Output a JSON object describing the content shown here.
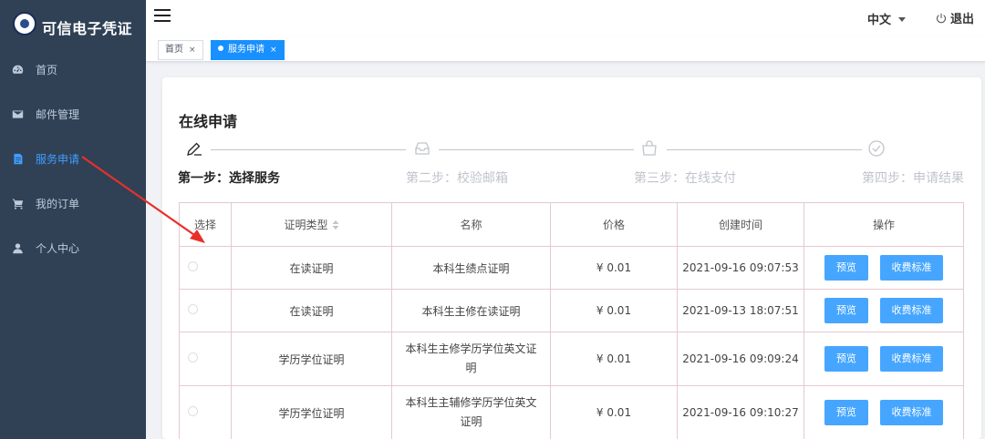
{
  "sidebar": {
    "brand": "可信电子凭证",
    "items": [
      {
        "label": "首页",
        "icon": "dashboard-icon"
      },
      {
        "label": "邮件管理",
        "icon": "envelope-icon"
      },
      {
        "label": "服务申请",
        "icon": "document-icon"
      },
      {
        "label": "我的订单",
        "icon": "cart-icon"
      },
      {
        "label": "个人中心",
        "icon": "user-icon"
      }
    ],
    "active_index": 2,
    "active_color": "#409eff"
  },
  "topbar": {
    "language": "中文",
    "logout": "退出"
  },
  "tags": [
    {
      "label": "首页",
      "active": false
    },
    {
      "label": "服务申请",
      "active": true
    }
  ],
  "tag_close": "×",
  "page": {
    "title": "在线申请",
    "steps": [
      {
        "label": "第一步：选择服务",
        "icon": "pencil-icon",
        "active": true
      },
      {
        "label": "第二步：校验邮箱",
        "icon": "inbox-icon",
        "active": false
      },
      {
        "label": "第三步：在线支付",
        "icon": "shopping-bag-icon",
        "active": false
      },
      {
        "label": "第四步：申请结果",
        "icon": "check-circle-icon",
        "active": false
      }
    ]
  },
  "table": {
    "columns": [
      "选择",
      "证明类型",
      "名称",
      "价格",
      "创建时间",
      "操作"
    ],
    "rows": [
      {
        "type": "在读证明",
        "name": "本科生绩点证明",
        "price": "¥ 0.01",
        "created": "2021-09-16 09:07:53"
      },
      {
        "type": "在读证明",
        "name": "本科生主修在读证明",
        "price": "¥ 0.01",
        "created": "2021-09-13 18:07:51"
      },
      {
        "type": "学历学位证明",
        "name": "本科生主修学历学位英文证明",
        "price": "¥ 0.01",
        "created": "2021-09-16 09:09:24"
      },
      {
        "type": "学历学位证明",
        "name": "本科生主辅修学历学位英文证明",
        "price": "¥ 0.01",
        "created": "2021-09-16 09:10:27"
      }
    ],
    "preview_label": "预览",
    "fee_label": "收费标准"
  },
  "colors": {
    "sidebar_bg": "#304156",
    "primary": "#1890ff",
    "button": "#46a6ff",
    "annotation_arrow": "#e8302a"
  }
}
